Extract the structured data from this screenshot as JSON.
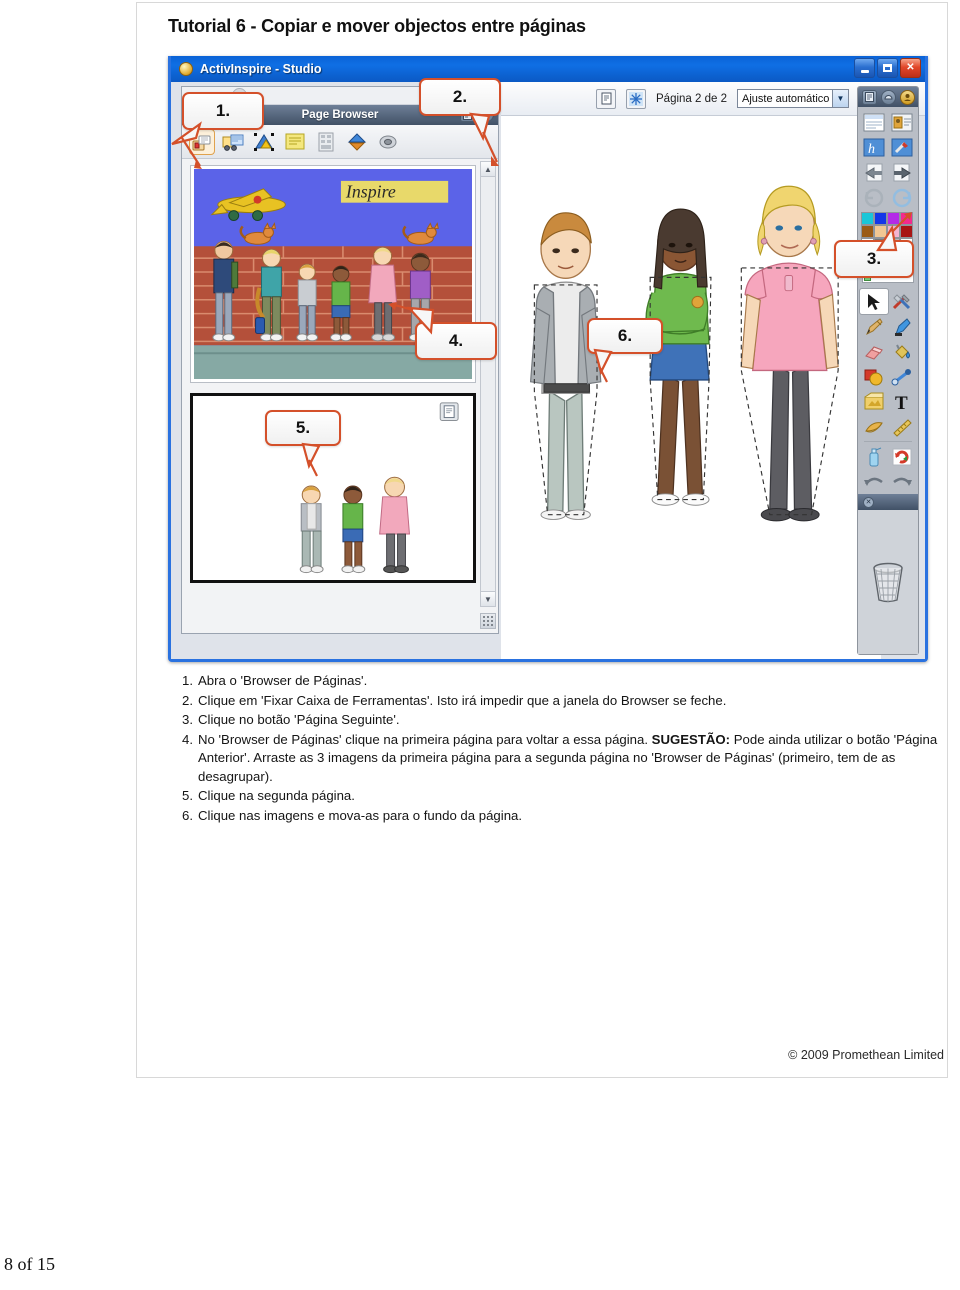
{
  "document": {
    "title": "Tutorial 6 - Copiar e mover objectos entre páginas",
    "copyright": "© 2009 Promethean Limited",
    "page_label": "8 of 15"
  },
  "app_window": {
    "title": "ActivInspire - Studio",
    "window_buttons": [
      {
        "name": "minimize",
        "glyph": "_"
      },
      {
        "name": "maximize",
        "glyph": "□"
      },
      {
        "name": "close",
        "glyph": "✕"
      }
    ],
    "toolstrip": {
      "notes_button": "notes-icon",
      "snowflake_button": "snowflake-icon",
      "page_indicator": "Página 2 de 2",
      "zoom_value": "Ajuste automático",
      "zoom_options": [
        "Ajuste automático"
      ],
      "expand_button": "expand-icon"
    }
  },
  "page_browser": {
    "title": "Page Browser",
    "close_tab_icon": "close-icon",
    "header_icons": [
      "notes-icon",
      "pin-icon"
    ],
    "toolbar_icons": [
      "page-browser-icon",
      "resource-browser-icon",
      "object-browser-icon",
      "notes-browser-icon",
      "property-browser-icon",
      "action-browser-icon",
      "voting-browser-icon"
    ],
    "thumbnails": [
      {
        "name": "page-1-thumbnail",
        "selected": false,
        "caption": "Inspire"
      },
      {
        "name": "page-2-thumbnail",
        "selected": true,
        "caption": ""
      }
    ]
  },
  "right_toolbar": {
    "header_icons": [
      "menu-icon",
      "dashboard-icon",
      "profile-icon"
    ],
    "tools": [
      "page-notes-icon",
      "profile-tool-icon",
      "handwriting-icon",
      "tool-settings-icon",
      "previous-page-icon",
      "next-page-icon",
      "undo-history-icon",
      "redo-history-icon",
      "select-icon",
      "toolbox-icon",
      "pen-icon",
      "highlighter-icon",
      "eraser-icon",
      "fill-icon",
      "shape-icon",
      "connector-icon",
      "clipart-icon",
      "text-icon",
      "camera-icon",
      "ruler-icon",
      "clear-icon",
      "reset-icon",
      "undo-icon",
      "redo-icon"
    ],
    "palette_row1": [
      "#19c6d8",
      "#1436e8",
      "#b42ae8",
      "#f22a8f"
    ],
    "palette_row2": [
      "#9a5a16",
      "#f2c793",
      "#f3b4cf",
      "#a81414"
    ],
    "palette_row3": [
      "#111111",
      "#7a7a7a",
      "#bdbdbd",
      "#ffffff"
    ],
    "selected_swatch": "#111111",
    "pen_width_dots": [
      2,
      4,
      7,
      11
    ],
    "trash_icon": "trash-bin-icon"
  },
  "canvas": {
    "figures": [
      "boy-grey-jacket",
      "girl-green-top",
      "girl-pink-dress"
    ]
  },
  "callouts": [
    {
      "id": "callout-1",
      "label": "1."
    },
    {
      "id": "callout-2",
      "label": "2."
    },
    {
      "id": "callout-3",
      "label": "3."
    },
    {
      "id": "callout-4",
      "label": "4."
    },
    {
      "id": "callout-5",
      "label": "5."
    },
    {
      "id": "callout-6",
      "label": "6."
    }
  ],
  "instructions": [
    {
      "num": "1.",
      "html": "Abra o 'Browser de Páginas'."
    },
    {
      "num": "2.",
      "html": "Clique em 'Fixar Caixa de Ferramentas'. Isto irá impedir que a janela do Browser se feche."
    },
    {
      "num": "3.",
      "html": "Clique no botão 'Página Seguinte'."
    },
    {
      "num": "4.",
      "html": "No 'Browser de Páginas' clique na primeira página para voltar a essa página. <b>SUGESTÃO:</b> Pode ainda utilizar o botão 'Página Anterior'. Arraste as 3 imagens da primeira página para a segunda página no 'Browser de Páginas' (primeiro, tem de as desagrupar)."
    },
    {
      "num": "5.",
      "html": "Clique na segunda página."
    },
    {
      "num": "6.",
      "html": "Clique nas imagens e mova-as para o fundo da página."
    }
  ]
}
